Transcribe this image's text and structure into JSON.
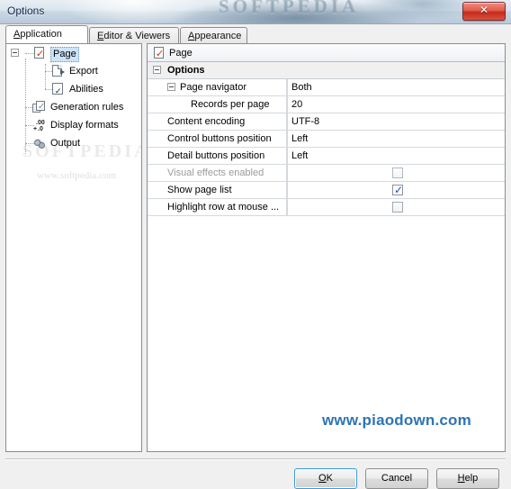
{
  "window": {
    "title": "Options",
    "close_label": "✕",
    "watermark_title": "SOFTPEDIA"
  },
  "tabs": [
    {
      "label": "Application",
      "mnemonic": "A",
      "active": true
    },
    {
      "label": "Editor & Viewers",
      "mnemonic": "E",
      "active": false
    },
    {
      "label": "Appearance",
      "mnemonic": "A",
      "active": false
    }
  ],
  "tree": {
    "watermark_big": "SOFTPEDIA",
    "watermark_small": "www.softpedia.com",
    "items": [
      {
        "label": "Page",
        "icon": "page-check-icon",
        "selected": true,
        "expanded": true,
        "level": 0
      },
      {
        "label": "Export",
        "icon": "export-icon",
        "selected": false,
        "level": 1
      },
      {
        "label": "Abilities",
        "icon": "abilities-icon",
        "selected": false,
        "level": 1
      },
      {
        "label": "Generation rules",
        "icon": "generation-rules-icon",
        "selected": false,
        "level": 0
      },
      {
        "label": "Display formats",
        "icon": "display-formats-icon",
        "selected": false,
        "level": 0
      },
      {
        "label": "Output",
        "icon": "output-gear-icon",
        "selected": false,
        "level": 0
      }
    ]
  },
  "grid": {
    "header": {
      "title": "Page",
      "icon": "page-check-icon"
    },
    "category": "Options",
    "rows": [
      {
        "name": "Page navigator",
        "value": "Both",
        "type": "text",
        "indent": 0,
        "expander": true,
        "disabled": false
      },
      {
        "name": "Records per page",
        "value": "20",
        "type": "text",
        "indent": 2,
        "expander": false,
        "disabled": false
      },
      {
        "name": "Content encoding",
        "value": "UTF-8",
        "type": "text",
        "indent": 1,
        "expander": false,
        "disabled": false
      },
      {
        "name": "Control buttons position",
        "value": "Left",
        "type": "text",
        "indent": 1,
        "expander": false,
        "disabled": false
      },
      {
        "name": "Detail buttons position",
        "value": "Left",
        "type": "text",
        "indent": 1,
        "expander": false,
        "disabled": false
      },
      {
        "name": "Visual effects enabled",
        "value": "",
        "type": "checkbox",
        "checked": false,
        "indent": 1,
        "expander": false,
        "disabled": true
      },
      {
        "name": "Show page list",
        "value": "",
        "type": "checkbox",
        "checked": true,
        "indent": 1,
        "expander": false,
        "disabled": false
      },
      {
        "name": "Highlight row at mouse ...",
        "value": "",
        "type": "checkbox",
        "checked": false,
        "indent": 1,
        "expander": false,
        "disabled": false
      }
    ],
    "watermark": "www.piaodown.com"
  },
  "footer": {
    "ok": "OK",
    "ok_mnemonic": "O",
    "cancel": "Cancel",
    "help": "Help",
    "help_mnemonic": "H"
  }
}
